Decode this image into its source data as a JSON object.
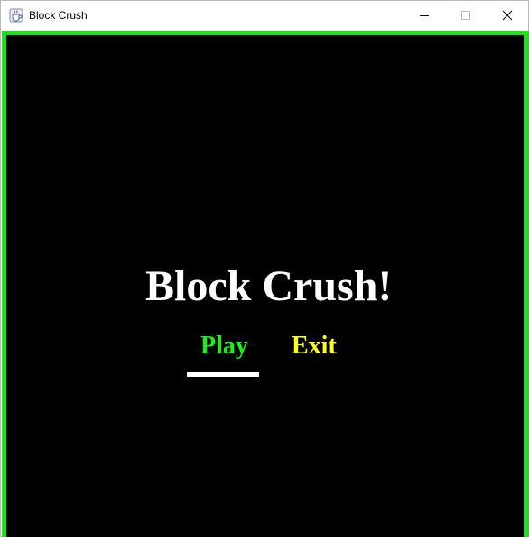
{
  "window": {
    "title": "Block Crush",
    "icon": "java-cup-icon",
    "controls": [
      "minimize-icon",
      "maximize-icon",
      "close-icon"
    ]
  },
  "game": {
    "title": "Block Crush!",
    "menu": {
      "options": [
        "Play",
        "Exit"
      ],
      "selected": "Play"
    },
    "colors": {
      "frame_border": "#1be31b",
      "background": "#000000",
      "title": "#ffffff",
      "play": "#18f018",
      "exit": "#ffff1a",
      "selector": "#ffffff"
    }
  }
}
